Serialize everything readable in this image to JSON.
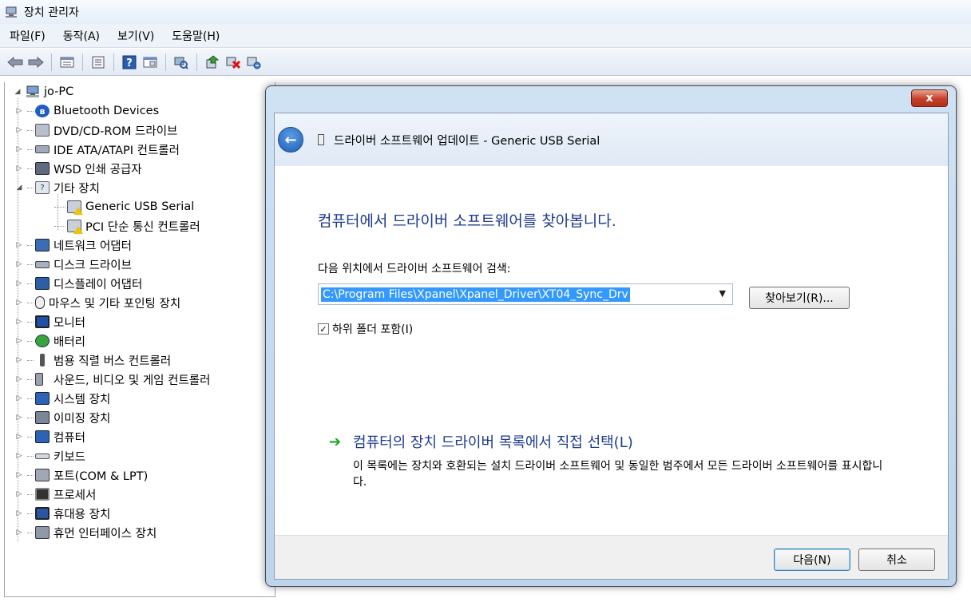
{
  "window": {
    "title": "장치 관리자"
  },
  "menu": [
    "파일(F)",
    "동작(A)",
    "보기(V)",
    "도움말(H)"
  ],
  "toolbar": {
    "buttons": [
      "back-icon",
      "forward-icon",
      "properties-icon",
      "show-hide-icon",
      "help-icon",
      "view-icon",
      "scan-icon",
      "update-driver-icon",
      "uninstall-icon",
      "enable-icon"
    ]
  },
  "tree": {
    "root": "jo-PC",
    "categories": [
      {
        "label": "Bluetooth Devices",
        "icon": "bluetooth-icon",
        "expanded": false
      },
      {
        "label": "DVD/CD-ROM 드라이브",
        "icon": "dvd-drive-icon",
        "expanded": false
      },
      {
        "label": "IDE ATA/ATAPI 컨트롤러",
        "icon": "ide-controller-icon",
        "expanded": false
      },
      {
        "label": "WSD 인쇄 공급자",
        "icon": "printer-icon",
        "expanded": false
      },
      {
        "label": "기타 장치",
        "icon": "other-devices-icon",
        "expanded": true,
        "children": [
          "Generic USB Serial",
          "PCI 단순 통신 컨트롤러"
        ]
      },
      {
        "label": "네트워크 어댑터",
        "icon": "network-adapter-icon",
        "expanded": false
      },
      {
        "label": "디스크 드라이브",
        "icon": "disk-drive-icon",
        "expanded": false
      },
      {
        "label": "디스플레이 어댑터",
        "icon": "display-adapter-icon",
        "expanded": false
      },
      {
        "label": "마우스 및 기타 포인팅 장치",
        "icon": "mouse-icon",
        "expanded": false
      },
      {
        "label": "모니터",
        "icon": "monitor-icon",
        "expanded": false
      },
      {
        "label": "배터리",
        "icon": "battery-icon",
        "expanded": false
      },
      {
        "label": "범용 직렬 버스 컨트롤러",
        "icon": "usb-icon",
        "expanded": false
      },
      {
        "label": "사운드, 비디오 및 게임 컨트롤러",
        "icon": "sound-icon",
        "expanded": false
      },
      {
        "label": "시스템 장치",
        "icon": "system-device-icon",
        "expanded": false
      },
      {
        "label": "이미징 장치",
        "icon": "imaging-device-icon",
        "expanded": false
      },
      {
        "label": "컴퓨터",
        "icon": "computer-icon",
        "expanded": false
      },
      {
        "label": "키보드",
        "icon": "keyboard-icon",
        "expanded": false
      },
      {
        "label": "포트(COM & LPT)",
        "icon": "port-icon",
        "expanded": false
      },
      {
        "label": "프로세서",
        "icon": "processor-icon",
        "expanded": false
      },
      {
        "label": "휴대용 장치",
        "icon": "portable-device-icon",
        "expanded": false
      },
      {
        "label": "휴먼 인터페이스 장치",
        "icon": "hid-icon",
        "expanded": false
      }
    ]
  },
  "dialog": {
    "close_label": "x",
    "header_title": "드라이버 소프트웨어 업데이트 - Generic USB Serial",
    "heading": "컴퓨터에서 드라이버 소프트웨어를 찾아봅니다.",
    "search_label": "다음 위치에서 드라이버 소프트웨어 검색:",
    "path_value": "C:\\Program Files\\Xpanel\\Xpanel_Driver\\XT04_Sync_Drv",
    "browse_label": "찾아보기(R)...",
    "include_subfolders_label": "하위 폴더 포함(I)",
    "include_subfolders_checked": true,
    "pick_title": "컴퓨터의 장치 드라이버 목록에서 직접 선택(L)",
    "pick_desc": "이 목록에는 장치와 호환되는 설치 드라이버 소프트웨어 및 동일한 범주에서 모든 드라이버 소프트웨어를 표시합니다.",
    "next_label": "다음(N)",
    "cancel_label": "취소"
  },
  "colors": {
    "heading": "#1e3a8f",
    "selection": "#3399ff",
    "close_button": "#c5402a",
    "link_arrow": "#1da31d"
  }
}
